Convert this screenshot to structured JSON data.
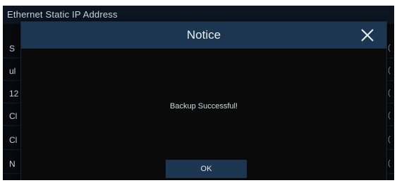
{
  "background": {
    "header_text": "Ethernet Static IP Address",
    "rows": [
      {
        "label": "S",
        "value": "("
      },
      {
        "label": "ul",
        "value": "("
      },
      {
        "label": "12",
        "value": "("
      },
      {
        "label": "Cl",
        "value": "("
      },
      {
        "label": "Cl",
        "value": "("
      },
      {
        "label": "N",
        "value": "("
      }
    ]
  },
  "dialog": {
    "title": "Notice",
    "message": "Backup Successful!",
    "ok_label": "OK",
    "close_icon": "close-icon"
  },
  "colors": {
    "header_bar": "#1c3550",
    "dialog_body": "#0a0a0b",
    "text": "#e8eef5"
  }
}
